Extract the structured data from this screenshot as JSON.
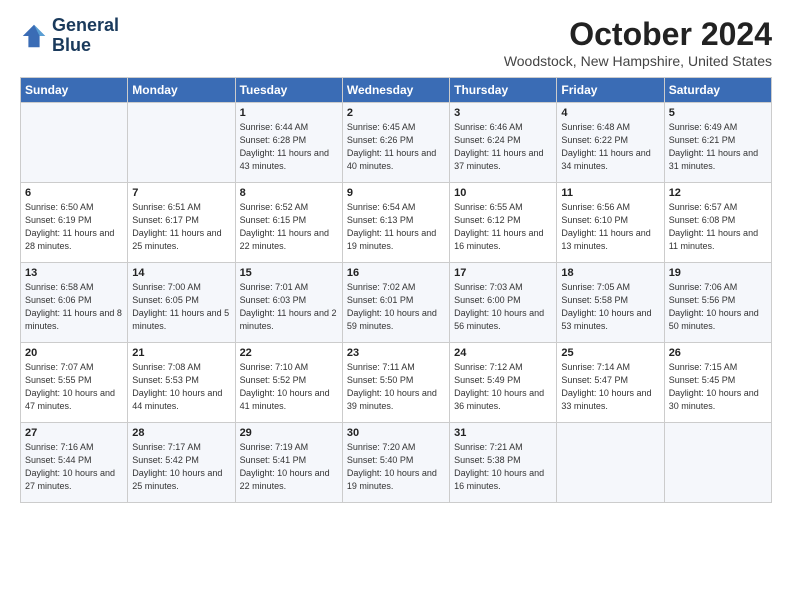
{
  "logo": {
    "line1": "General",
    "line2": "Blue"
  },
  "title": "October 2024",
  "location": "Woodstock, New Hampshire, United States",
  "days_of_week": [
    "Sunday",
    "Monday",
    "Tuesday",
    "Wednesday",
    "Thursday",
    "Friday",
    "Saturday"
  ],
  "weeks": [
    [
      {
        "day": "",
        "content": ""
      },
      {
        "day": "",
        "content": ""
      },
      {
        "day": "1",
        "content": "Sunrise: 6:44 AM\nSunset: 6:28 PM\nDaylight: 11 hours and 43 minutes."
      },
      {
        "day": "2",
        "content": "Sunrise: 6:45 AM\nSunset: 6:26 PM\nDaylight: 11 hours and 40 minutes."
      },
      {
        "day": "3",
        "content": "Sunrise: 6:46 AM\nSunset: 6:24 PM\nDaylight: 11 hours and 37 minutes."
      },
      {
        "day": "4",
        "content": "Sunrise: 6:48 AM\nSunset: 6:22 PM\nDaylight: 11 hours and 34 minutes."
      },
      {
        "day": "5",
        "content": "Sunrise: 6:49 AM\nSunset: 6:21 PM\nDaylight: 11 hours and 31 minutes."
      }
    ],
    [
      {
        "day": "6",
        "content": "Sunrise: 6:50 AM\nSunset: 6:19 PM\nDaylight: 11 hours and 28 minutes."
      },
      {
        "day": "7",
        "content": "Sunrise: 6:51 AM\nSunset: 6:17 PM\nDaylight: 11 hours and 25 minutes."
      },
      {
        "day": "8",
        "content": "Sunrise: 6:52 AM\nSunset: 6:15 PM\nDaylight: 11 hours and 22 minutes."
      },
      {
        "day": "9",
        "content": "Sunrise: 6:54 AM\nSunset: 6:13 PM\nDaylight: 11 hours and 19 minutes."
      },
      {
        "day": "10",
        "content": "Sunrise: 6:55 AM\nSunset: 6:12 PM\nDaylight: 11 hours and 16 minutes."
      },
      {
        "day": "11",
        "content": "Sunrise: 6:56 AM\nSunset: 6:10 PM\nDaylight: 11 hours and 13 minutes."
      },
      {
        "day": "12",
        "content": "Sunrise: 6:57 AM\nSunset: 6:08 PM\nDaylight: 11 hours and 11 minutes."
      }
    ],
    [
      {
        "day": "13",
        "content": "Sunrise: 6:58 AM\nSunset: 6:06 PM\nDaylight: 11 hours and 8 minutes."
      },
      {
        "day": "14",
        "content": "Sunrise: 7:00 AM\nSunset: 6:05 PM\nDaylight: 11 hours and 5 minutes."
      },
      {
        "day": "15",
        "content": "Sunrise: 7:01 AM\nSunset: 6:03 PM\nDaylight: 11 hours and 2 minutes."
      },
      {
        "day": "16",
        "content": "Sunrise: 7:02 AM\nSunset: 6:01 PM\nDaylight: 10 hours and 59 minutes."
      },
      {
        "day": "17",
        "content": "Sunrise: 7:03 AM\nSunset: 6:00 PM\nDaylight: 10 hours and 56 minutes."
      },
      {
        "day": "18",
        "content": "Sunrise: 7:05 AM\nSunset: 5:58 PM\nDaylight: 10 hours and 53 minutes."
      },
      {
        "day": "19",
        "content": "Sunrise: 7:06 AM\nSunset: 5:56 PM\nDaylight: 10 hours and 50 minutes."
      }
    ],
    [
      {
        "day": "20",
        "content": "Sunrise: 7:07 AM\nSunset: 5:55 PM\nDaylight: 10 hours and 47 minutes."
      },
      {
        "day": "21",
        "content": "Sunrise: 7:08 AM\nSunset: 5:53 PM\nDaylight: 10 hours and 44 minutes."
      },
      {
        "day": "22",
        "content": "Sunrise: 7:10 AM\nSunset: 5:52 PM\nDaylight: 10 hours and 41 minutes."
      },
      {
        "day": "23",
        "content": "Sunrise: 7:11 AM\nSunset: 5:50 PM\nDaylight: 10 hours and 39 minutes."
      },
      {
        "day": "24",
        "content": "Sunrise: 7:12 AM\nSunset: 5:49 PM\nDaylight: 10 hours and 36 minutes."
      },
      {
        "day": "25",
        "content": "Sunrise: 7:14 AM\nSunset: 5:47 PM\nDaylight: 10 hours and 33 minutes."
      },
      {
        "day": "26",
        "content": "Sunrise: 7:15 AM\nSunset: 5:45 PM\nDaylight: 10 hours and 30 minutes."
      }
    ],
    [
      {
        "day": "27",
        "content": "Sunrise: 7:16 AM\nSunset: 5:44 PM\nDaylight: 10 hours and 27 minutes."
      },
      {
        "day": "28",
        "content": "Sunrise: 7:17 AM\nSunset: 5:42 PM\nDaylight: 10 hours and 25 minutes."
      },
      {
        "day": "29",
        "content": "Sunrise: 7:19 AM\nSunset: 5:41 PM\nDaylight: 10 hours and 22 minutes."
      },
      {
        "day": "30",
        "content": "Sunrise: 7:20 AM\nSunset: 5:40 PM\nDaylight: 10 hours and 19 minutes."
      },
      {
        "day": "31",
        "content": "Sunrise: 7:21 AM\nSunset: 5:38 PM\nDaylight: 10 hours and 16 minutes."
      },
      {
        "day": "",
        "content": ""
      },
      {
        "day": "",
        "content": ""
      }
    ]
  ]
}
